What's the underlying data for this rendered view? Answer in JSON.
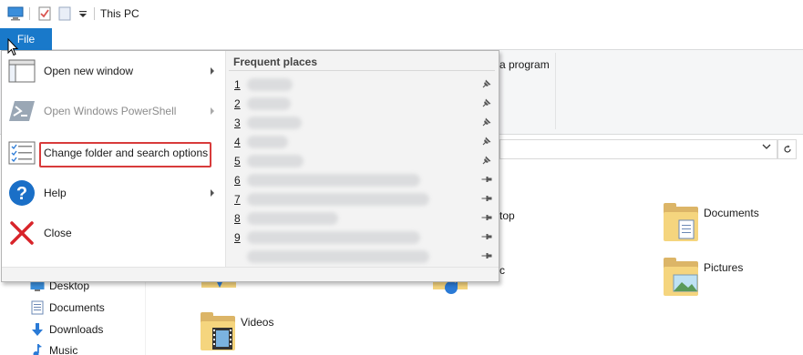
{
  "window": {
    "title": "This PC"
  },
  "ribbon": {
    "file_tab_label": "File",
    "partial_text": "a program"
  },
  "file_menu": {
    "items": [
      {
        "label": "Open new window",
        "icon": "new-window-icon",
        "has_submenu": true,
        "enabled": true
      },
      {
        "label": "Open Windows PowerShell",
        "icon": "powershell-icon",
        "has_submenu": true,
        "enabled": false
      },
      {
        "label": "Change folder and search options",
        "icon": "folder-options-icon",
        "has_submenu": false,
        "enabled": true,
        "highlighted": true
      },
      {
        "label": "Help",
        "icon": "help-icon",
        "has_submenu": true,
        "enabled": true
      },
      {
        "label": "Close",
        "icon": "close-icon",
        "has_submenu": false,
        "enabled": true
      }
    ],
    "frequent_places": {
      "header": "Frequent places",
      "rows": [
        {
          "num": "1",
          "pinned": true
        },
        {
          "num": "2",
          "pinned": true
        },
        {
          "num": "3",
          "pinned": true
        },
        {
          "num": "4",
          "pinned": true
        },
        {
          "num": "5",
          "pinned": true
        },
        {
          "num": "6",
          "pinned": false
        },
        {
          "num": "7",
          "pinned": false
        },
        {
          "num": "8",
          "pinned": false
        },
        {
          "num": "9",
          "pinned": false
        },
        {
          "num": "",
          "pinned": false
        }
      ]
    }
  },
  "nav_pane": {
    "items": [
      {
        "label": "Desktop",
        "icon": "desktop-icon"
      },
      {
        "label": "Documents",
        "icon": "documents-icon"
      },
      {
        "label": "Downloads",
        "icon": "downloads-icon"
      },
      {
        "label": "Music",
        "icon": "music-icon"
      }
    ]
  },
  "content": {
    "folders": [
      {
        "label": "Documents",
        "icon": "documents-folder-icon"
      },
      {
        "label": "Pictures",
        "icon": "pictures-folder-icon"
      },
      {
        "label": "Videos",
        "icon": "videos-folder-icon"
      }
    ],
    "partial_desktop_label": "top",
    "partial_music_label": "c"
  },
  "colors": {
    "file_tab": "#1979ca",
    "highlight_border": "#d83b3b",
    "folder_front": "#f5d57e",
    "folder_back": "#dcb567"
  }
}
